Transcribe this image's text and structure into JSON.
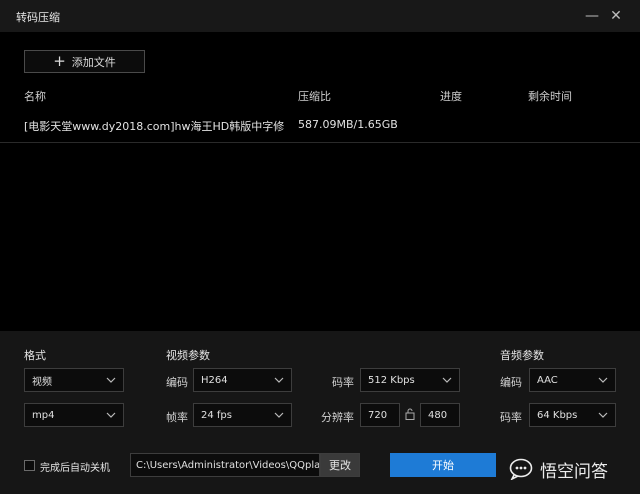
{
  "window": {
    "title": "转码压缩",
    "minimize_glyph": "—",
    "close_glyph": "✕"
  },
  "toolbar": {
    "add_file_label": "添加文件"
  },
  "list": {
    "headers": {
      "name": "名称",
      "ratio": "压缩比",
      "progress": "进度",
      "remaining": "剩余时间"
    },
    "rows": [
      {
        "name": "[电影天堂www.dy2018.com]hw海王HD韩版中字修",
        "ratio": "587.09MB/1.65GB",
        "progress": "",
        "remaining": ""
      }
    ]
  },
  "settings": {
    "format": {
      "label": "格式",
      "type": "视频",
      "container": "mp4"
    },
    "video": {
      "label": "视频参数",
      "codec_label": "编码",
      "codec": "H264",
      "fps_label": "帧率",
      "fps": "24 fps",
      "bitrate_label": "码率",
      "bitrate": "512 Kbps",
      "resolution_label": "分辨率",
      "width": "720",
      "height": "480"
    },
    "audio": {
      "label": "音频参数",
      "codec_label": "编码",
      "codec": "AAC",
      "bitrate_label": "码率",
      "bitrate": "64 Kbps"
    }
  },
  "footer": {
    "auto_shutdown_label": "完成后自动关机",
    "auto_shutdown_checked": false,
    "output_path": "C:\\Users\\Administrator\\Videos\\QQplayerC",
    "change_label": "更改",
    "start_label": "开始"
  },
  "watermark": {
    "text": "悟空问答"
  },
  "colors": {
    "accent": "#1e7bd6",
    "background": "#000000",
    "panel": "#161616",
    "titlebar": "#181818"
  }
}
